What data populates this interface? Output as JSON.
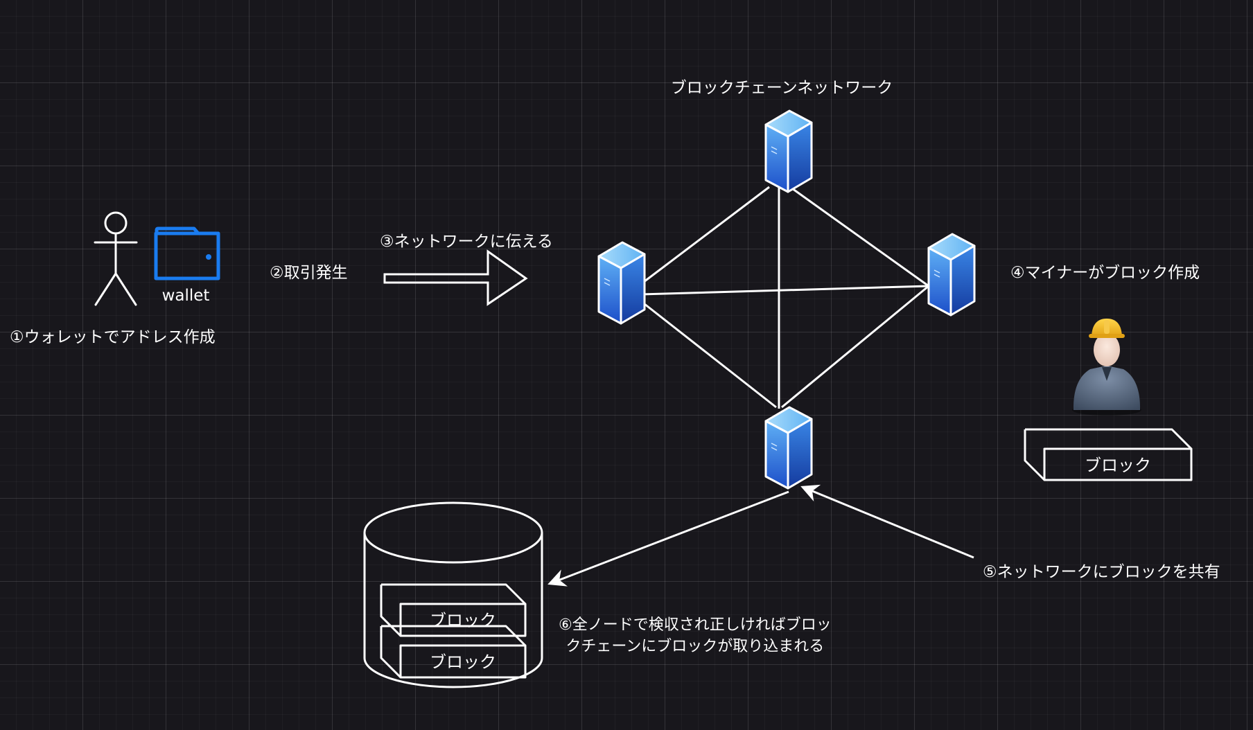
{
  "colors": {
    "background": "#18171c",
    "line": "#ffffff",
    "wallet_accent": "#1a7cf0",
    "server_face": "#2f80e8",
    "server_top": "#7dc7f5"
  },
  "network": {
    "title": "ブロックチェーンネットワーク",
    "node_icon": "server-icon"
  },
  "steps": {
    "step1": "①ウォレットでアドレス作成",
    "step2": "②取引発生",
    "step3": "③ネットワークに伝える",
    "step4": "④マイナーがブロック作成",
    "step5": "⑤ネットワークにブロックを共有",
    "step6": "⑥全ノードで検収され正しければブロッ\nクチェーンにブロックが取り込まれる"
  },
  "user": {
    "icon": "stick-figure-icon",
    "wallet_icon": "wallet-icon",
    "wallet_label": "wallet"
  },
  "miner": {
    "icon": "miner-with-hardhat-icon",
    "block_label": "ブロック"
  },
  "database": {
    "icon": "database-cylinder-icon",
    "blocks": [
      "ブロック",
      "ブロック"
    ]
  }
}
